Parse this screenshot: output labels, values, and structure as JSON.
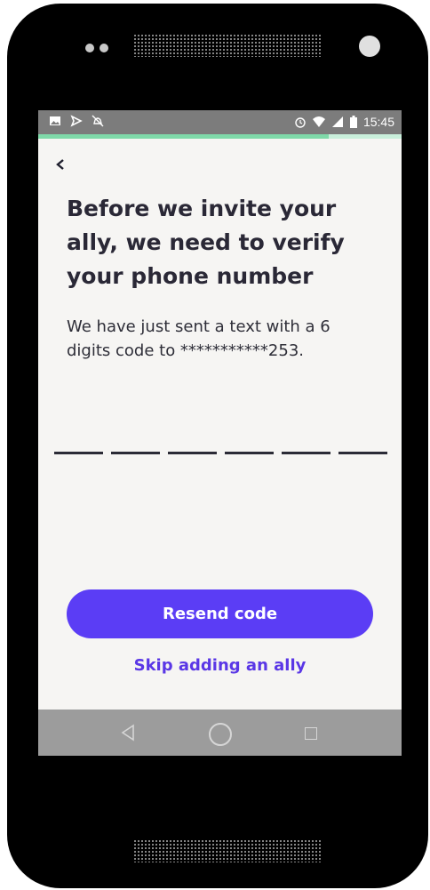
{
  "status_bar": {
    "time": "15:45",
    "left_icons": [
      "image-icon",
      "send-icon",
      "alarm-off-icon"
    ],
    "right_icons": [
      "alarm-icon",
      "wifi-icon",
      "signal-icon",
      "battery-icon"
    ]
  },
  "progress": {
    "fraction": 0.8,
    "fill_color": "#7fd9a9",
    "track_color": "#c9efdb"
  },
  "header": {
    "back_icon": "chevron-left-icon"
  },
  "main": {
    "title": "Before we invite your ally, we need to verify your phone number",
    "description": "We have just sent a text with a 6 digits code to ***********253.",
    "code_length": 6
  },
  "actions": {
    "resend_label": "Resend code",
    "skip_label": "Skip adding an ally"
  },
  "colors": {
    "accent": "#5b3df5",
    "link": "#5a37e6",
    "background": "#f6f5f3"
  },
  "nav_bar": {
    "icons": [
      "back-triangle-icon",
      "home-circle-icon",
      "recents-square-icon"
    ]
  }
}
